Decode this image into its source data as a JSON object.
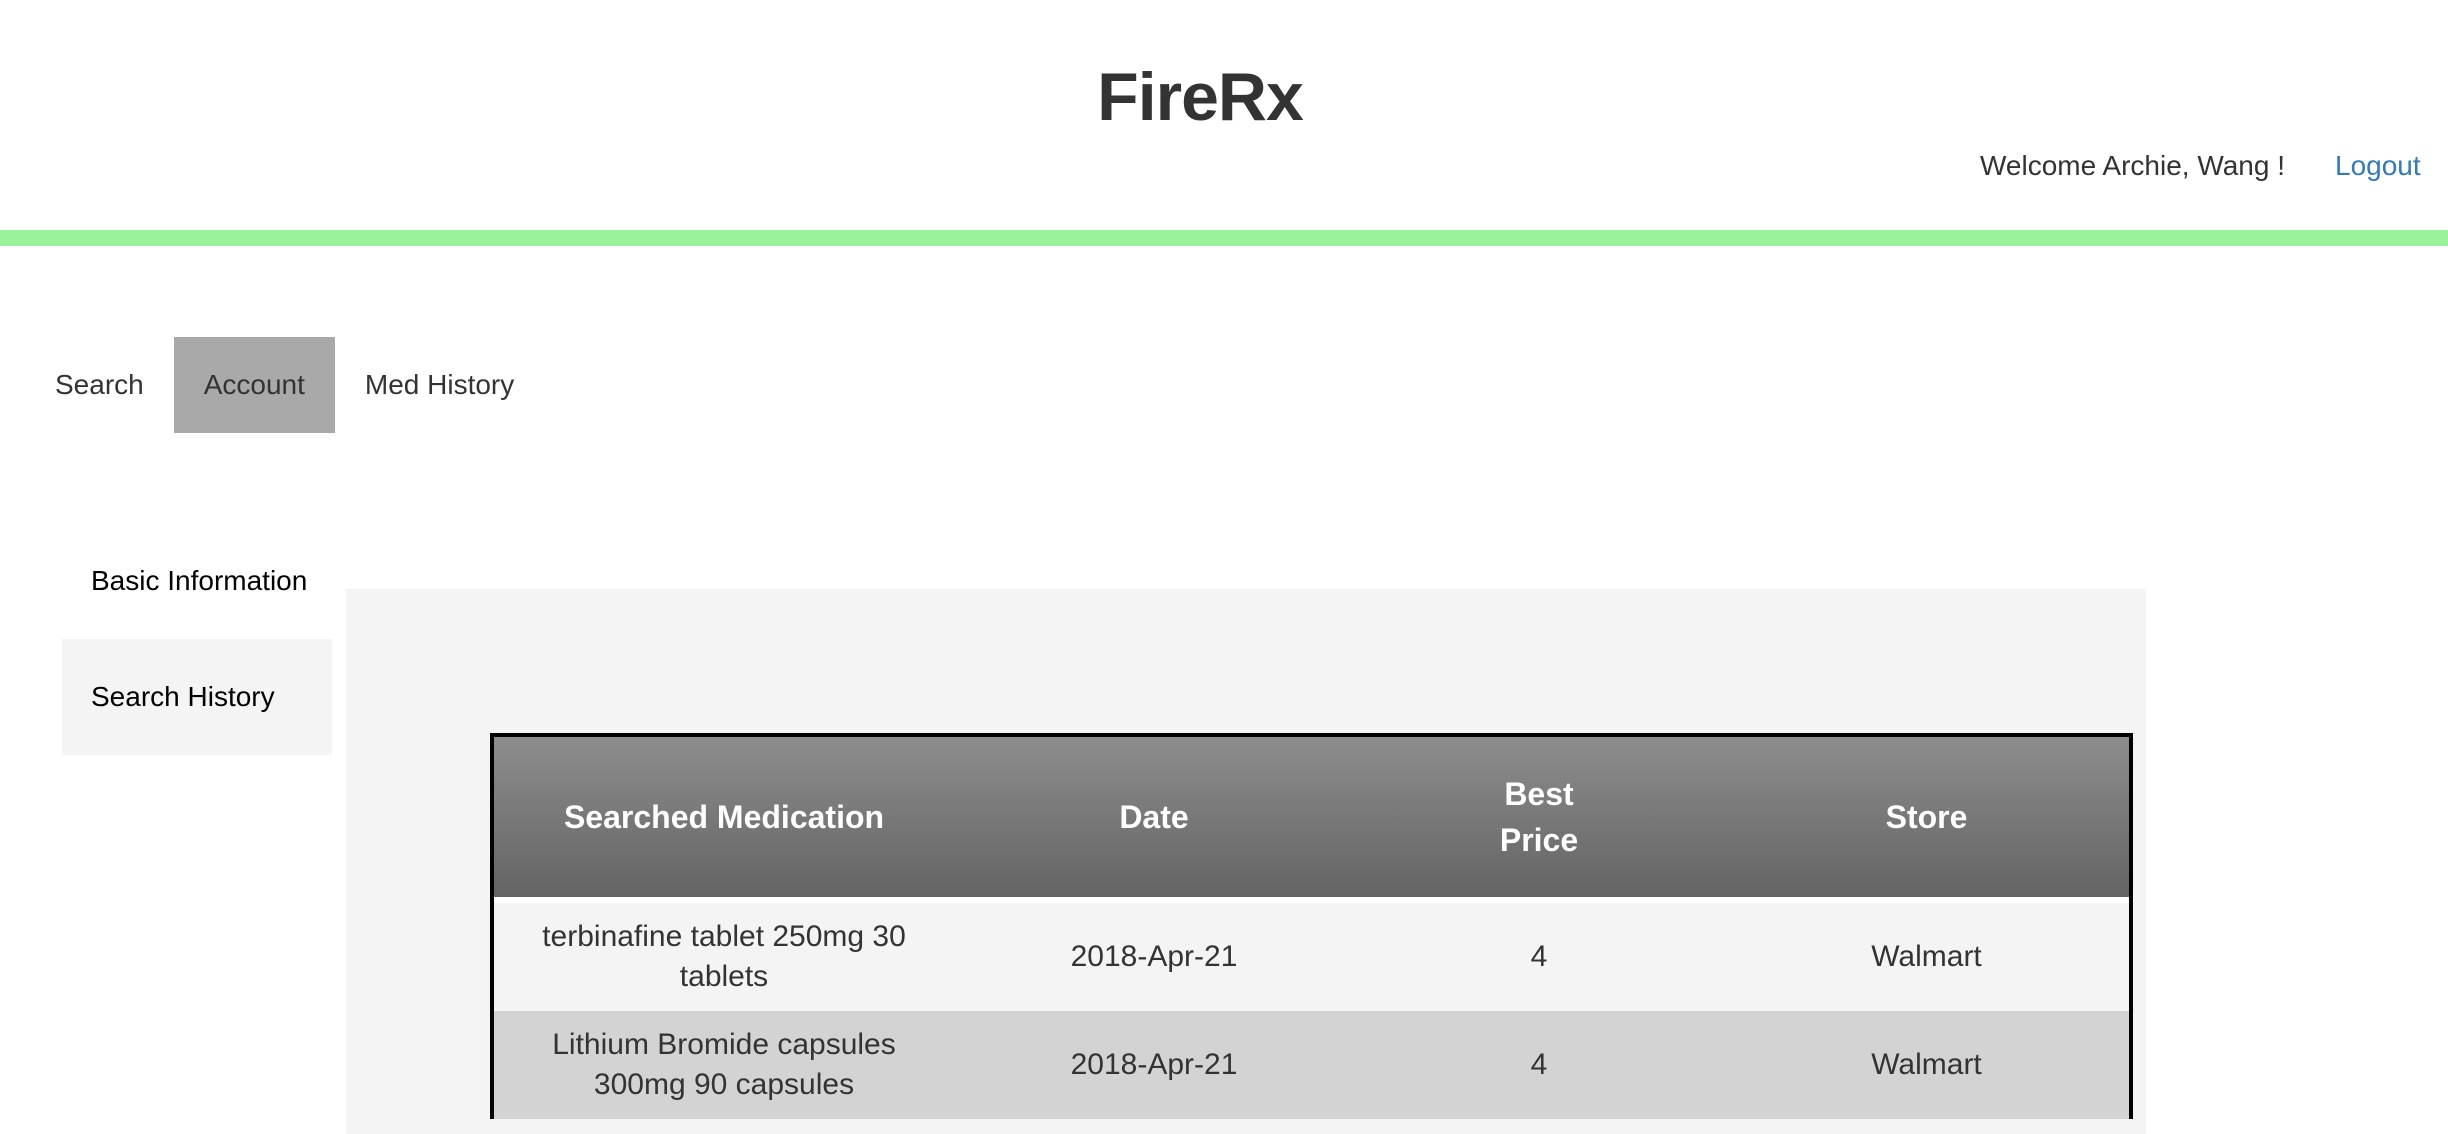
{
  "header": {
    "title": "FireRx",
    "welcome": "Welcome Archie, Wang !",
    "logout_label": "Logout"
  },
  "colors": {
    "accent_bar": "#98f39a",
    "active_tab": "#a9a9a9",
    "link": "#337ab7",
    "panel_bg": "#f4f4f4",
    "table_header_top": "#8d8d8d",
    "table_header_bottom": "#646464"
  },
  "main_nav": {
    "tabs": [
      {
        "label": "Search",
        "active": false
      },
      {
        "label": "Account",
        "active": true
      },
      {
        "label": "Med History",
        "active": false
      }
    ]
  },
  "side_nav": {
    "items": [
      {
        "label": "Basic Information",
        "active": false
      },
      {
        "label": "Search History",
        "active": true
      }
    ]
  },
  "search_history": {
    "columns": [
      "Searched Medication",
      "Date",
      "Best Price",
      "Store"
    ],
    "rows": [
      {
        "medication": "terbinafine tablet 250mg 30 tablets",
        "date": "2018-Apr-21",
        "price": "4",
        "store": "Walmart"
      },
      {
        "medication": "Lithium Bromide capsules 300mg 90 capsules",
        "date": "2018-Apr-21",
        "price": "4",
        "store": "Walmart"
      }
    ]
  }
}
